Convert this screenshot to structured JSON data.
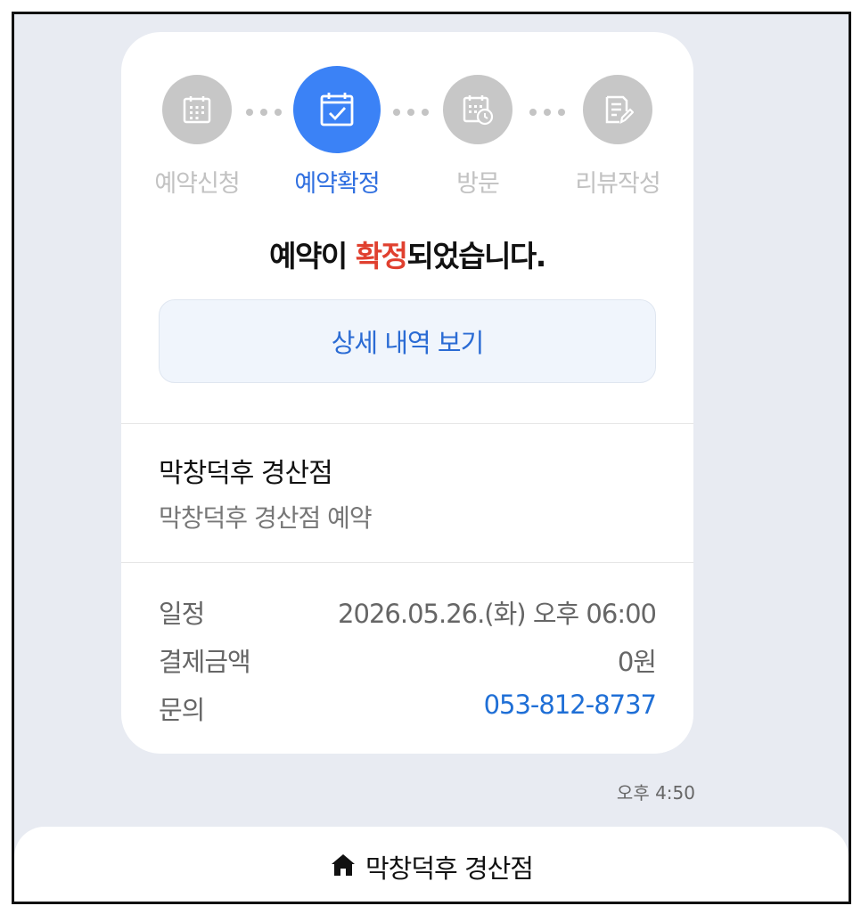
{
  "steps": [
    {
      "label": "예약신청",
      "icon": "calendar-grid-icon"
    },
    {
      "label": "예약확정",
      "icon": "calendar-check-icon"
    },
    {
      "label": "방문",
      "icon": "calendar-clock-icon"
    },
    {
      "label": "리뷰작성",
      "icon": "edit-note-icon"
    }
  ],
  "headline": {
    "pre": "예약이 ",
    "highlight": "확정",
    "post": "되었습니다."
  },
  "detail_button": {
    "label": "상세 내역 보기"
  },
  "store": {
    "name": "막창덕후 경산점",
    "subtitle": "막창덕후 경산점 예약"
  },
  "info": {
    "schedule_label": "일정",
    "schedule_value": "2026.05.26.(화) 오후 06:00",
    "payment_label": "결제금액",
    "payment_value": "0원",
    "contact_label": "문의",
    "contact_value": "053-812-8737"
  },
  "timestamp": "오후 4:50",
  "bottom_bar": {
    "label": "막창덕후 경산점",
    "icon": "home-icon"
  },
  "colors": {
    "accent": "#3b82f6",
    "highlight": "#e0402f",
    "link": "#1f6fd6",
    "inactive": "#c7c7c7"
  }
}
